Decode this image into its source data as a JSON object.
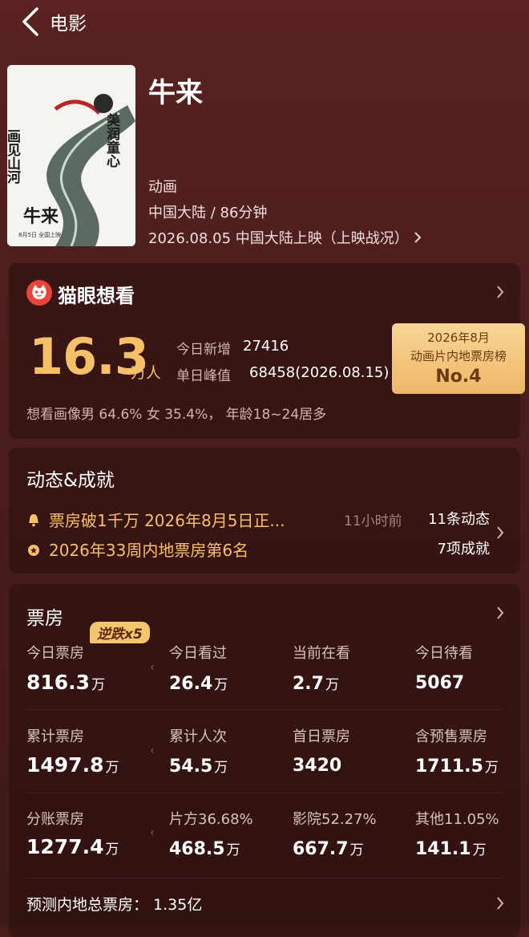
{
  "header": {
    "back_label": "电影"
  },
  "movie": {
    "title": "牛来",
    "genre": "动画",
    "region_duration": "中国大陆 / 86分钟",
    "release": "2026.08.05 中国大陆上映（上映战况）",
    "poster": {
      "left_text": "画见山河",
      "right_text": "美润童心",
      "bottom_title": "牛来",
      "bottom_sub": "8月5日 全国上映"
    }
  },
  "want_to_see": {
    "title": "猫眼想看",
    "total_value": "16.3",
    "total_unit": "万人",
    "today_new_label": "今日新增",
    "today_new_value": "27416",
    "daily_peak_label": "单日峰值",
    "daily_peak_value": "68458(2026.08.15)",
    "rank_line1": "2026年8月",
    "rank_line2": "动画片内地票房榜",
    "rank_line3": "No.4",
    "profile": "想看画像男 64.6%  女 35.4%， 年龄18~24居多"
  },
  "dynamics": {
    "title": "动态&成就",
    "row1_text": "票房破1千万 2026年8月5日正...",
    "row1_time": "11小时前",
    "row1_count": "11条动态",
    "row2_text": "2026年33周内地票房第6名",
    "row2_count": "7项成就"
  },
  "box_office": {
    "title": "票房",
    "tag": "逆跌x5",
    "row1": [
      {
        "label": "今日票房",
        "value": "816.3",
        "unit": "万"
      },
      {
        "label": "今日看过",
        "value": "26.4",
        "unit": "万"
      },
      {
        "label": "当前在看",
        "value": "2.7",
        "unit": "万"
      },
      {
        "label": "今日待看",
        "value": "5067",
        "unit": ""
      }
    ],
    "row2": [
      {
        "label": "累计票房",
        "value": "1497.8",
        "unit": "万"
      },
      {
        "label": "累计人次",
        "value": "54.5",
        "unit": "万"
      },
      {
        "label": "首日票房",
        "value": "3420",
        "unit": ""
      },
      {
        "label": "含预售票房",
        "value": "1711.5",
        "unit": "万"
      }
    ],
    "row3": [
      {
        "label": "分账票房",
        "value": "1277.4",
        "unit": "万"
      },
      {
        "label": "片方36.68%",
        "value": "468.5",
        "unit": "万"
      },
      {
        "label": "影院52.27%",
        "value": "667.7",
        "unit": "万"
      },
      {
        "label": "其他11.05%",
        "value": "141.1",
        "unit": "万"
      }
    ],
    "forecast": "预测内地总票房： 1.35亿"
  },
  "colors": {
    "accent": "#f6c069",
    "badge": "#eeb768",
    "background": "#4a1d1b"
  }
}
